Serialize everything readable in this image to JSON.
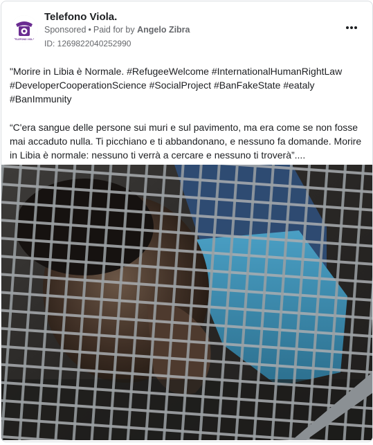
{
  "post": {
    "page_name": "Telefono Viola.",
    "sponsored_label": "Sponsored",
    "separator": "•",
    "paid_for_prefix": "Paid for by",
    "paid_for_name": "Angelo Zibra",
    "ad_id": "ID: 1269822040252990",
    "more_icon": "ellipsis-icon",
    "paragraph_1": "\"Morire in Libia è Normale. #RefugeeWelcome #InternationalHumanRightLaw #DeveloperCooperationScience #SocialProject #BanFakeState #eataly #BanImmunity",
    "paragraph_2": "“C'era sangue delle persone sui muri e sul pavimento, ma era come se non fosse mai accaduto nulla. Ti picchiano e ti abbandonano, e nessuno fa domande. Morire in Libia è normale: nessuno ti verrà a cercare e nessuno ti troverà”....",
    "logo_caption": "TELEFONO VIOLA"
  },
  "colors": {
    "text_primary": "#1c1e21",
    "text_secondary": "#65676b",
    "logo_purple": "#6a2c91",
    "border": "#dadde1"
  }
}
